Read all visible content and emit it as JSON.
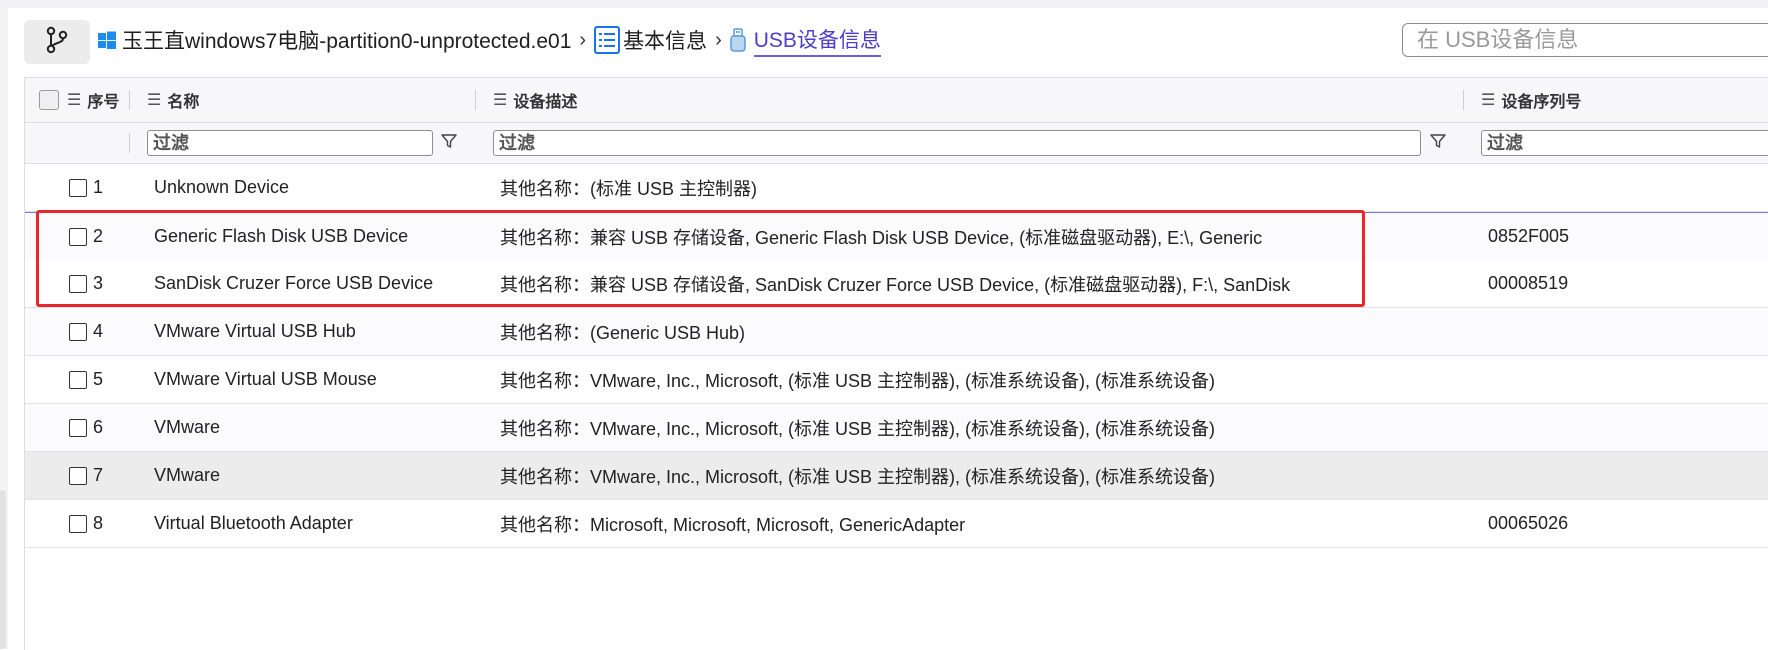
{
  "breadcrumb": {
    "items": [
      {
        "label": "玉王直windows7电脑-partition0-unprotected.e01",
        "icon": "windows-icon"
      },
      {
        "label": "基本信息",
        "icon": "list-icon"
      },
      {
        "label": "USB设备信息",
        "icon": "usb-icon"
      }
    ],
    "separator": "›"
  },
  "search": {
    "placeholder": "在 USB设备信息"
  },
  "table": {
    "headers": {
      "index": "序号",
      "name": "名称",
      "description": "设备描述",
      "serial": "设备序列号"
    },
    "filter_placeholder": "过滤",
    "rows": [
      {
        "index": "1",
        "name": "Unknown Device",
        "description": "其他名称：(标准 USB 主控制器)",
        "serial": ""
      },
      {
        "index": "2",
        "name": "Generic Flash Disk USB Device",
        "description": "其他名称：兼容 USB 存储设备, Generic Flash Disk USB Device, (标准磁盘驱动器), E:\\, Generic",
        "serial": "0852F005"
      },
      {
        "index": "3",
        "name": "SanDisk Cruzer Force USB Device",
        "description": "其他名称：兼容 USB 存储设备, SanDisk Cruzer Force USB Device, (标准磁盘驱动器), F:\\, SanDisk",
        "serial": "00008519"
      },
      {
        "index": "4",
        "name": "VMware Virtual USB Hub",
        "description": "其他名称：(Generic USB Hub)",
        "serial": ""
      },
      {
        "index": "5",
        "name": "VMware Virtual USB Mouse",
        "description": "其他名称：VMware, Inc., Microsoft, (标准 USB 主控制器), (标准系统设备), (标准系统设备)",
        "serial": ""
      },
      {
        "index": "6",
        "name": "VMware",
        "description": "其他名称：VMware, Inc., Microsoft, (标准 USB 主控制器), (标准系统设备), (标准系统设备)",
        "serial": ""
      },
      {
        "index": "7",
        "name": "VMware",
        "description": "其他名称：VMware, Inc., Microsoft, (标准 USB 主控制器), (标准系统设备), (标准系统设备)",
        "serial": ""
      },
      {
        "index": "8",
        "name": "Virtual Bluetooth Adapter",
        "description": "其他名称：Microsoft, Microsoft, Microsoft, GenericAdapter",
        "serial": "00065026"
      }
    ]
  },
  "colors": {
    "accent": "#4b3ec9",
    "highlight_box": "#e8272b",
    "hover_row": "#ececec"
  }
}
